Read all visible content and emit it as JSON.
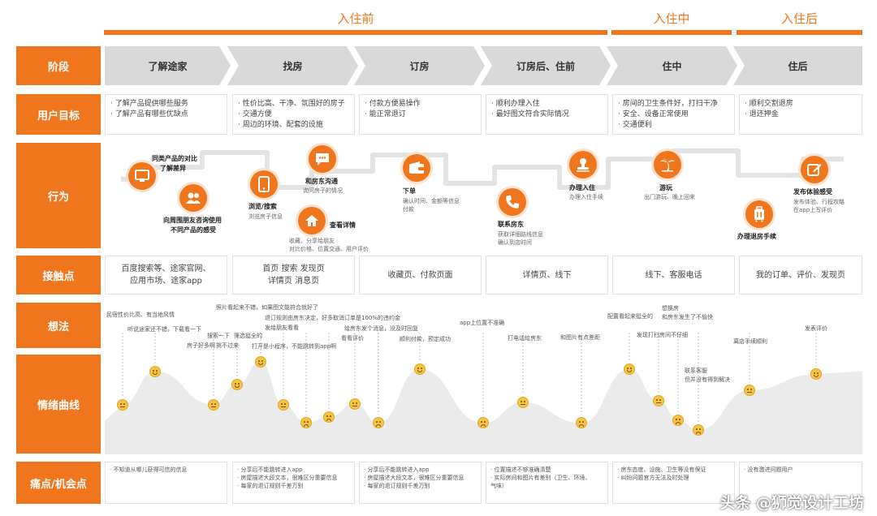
{
  "phases": [
    {
      "title": "入住前"
    },
    {
      "title": "入住中"
    },
    {
      "title": "入住后"
    }
  ],
  "row_labels": [
    "阶段",
    "用户目标",
    "行为",
    "接触点",
    "想法",
    "情绪曲线",
    "痛点/机会点"
  ],
  "stages": [
    "了解途家",
    "找房",
    "订房",
    "订房后、住前",
    "住中",
    "住后"
  ],
  "goals": [
    [
      "· 了解产品提供哪些服务",
      "· 了解产品有哪些优缺点"
    ],
    [
      "· 性价比高、干净、氛围好的房子",
      "· 交通方便",
      "· 周边的环境、配套的设施"
    ],
    [
      "· 付款方便易操作",
      "· 能正常退订"
    ],
    [
      "· 顺利办理入住",
      "· 最好图文符合实际情况"
    ],
    [
      "· 房间的卫生条件好，打扫干净",
      "· 安全、设备正常使用",
      "· 交通便利"
    ],
    [
      "· 顺利交割退房",
      "· 退还押金"
    ]
  ],
  "actions": [
    {
      "icon": "monitor-icon",
      "title": "同类产品的对比",
      "title2": "了解差异",
      "desc": ""
    },
    {
      "icon": "users-icon",
      "title": "向周围朋友咨询使用",
      "title2": "不同产品的感受",
      "desc": ""
    },
    {
      "icon": "phone-icon",
      "title": "浏览/搜索",
      "title2": "",
      "desc": "浏览房子信息"
    },
    {
      "icon": "chat-icon",
      "title": "和房东沟通",
      "title2": "",
      "desc": "询问房子的情况"
    },
    {
      "icon": "home-icon",
      "title": "查看详情",
      "title2": "",
      "desc": "收藏、分享给朋友",
      "desc2": "对比价格、位置交通、用户评价"
    },
    {
      "icon": "wallet-icon",
      "title": "下单",
      "title2": "",
      "desc": "确认时间、金额等信息",
      "desc2": "付款"
    },
    {
      "icon": "call-icon",
      "title": "联系房东",
      "title2": "",
      "desc": "获取详细路线信息",
      "desc2": "确认到店时间"
    },
    {
      "icon": "stamp-icon",
      "title": "办理入住",
      "title2": "",
      "desc": "办理入住手续"
    },
    {
      "icon": "palm-icon",
      "title": "游玩",
      "title2": "",
      "desc": "出门游玩、晚上回来"
    },
    {
      "icon": "luggage-icon",
      "title": "办理退房手续",
      "title2": "",
      "desc": ""
    },
    {
      "icon": "edit-icon",
      "title": "发布体验感受",
      "title2": "",
      "desc": "发布体验、行程攻略",
      "desc2": "在app上写评价"
    }
  ],
  "touchpoints": [
    [
      "百度搜索等、途家官网、",
      "应用市场、途家app"
    ],
    [
      "首页 搜索 发现页",
      "详情页 消息页"
    ],
    [
      "收藏页、付款页面"
    ],
    [
      "详情页、线下"
    ],
    [
      "线下、客服电话"
    ],
    [
      "我的订单、评价、发现页"
    ]
  ],
  "thoughts": [
    "民宿性价比高、有当地风情",
    "听说途家还不错，下载看一下",
    "搜索一下",
    "房子好多啊",
    "挑不过来",
    "照片看起来不错，如果图文能符合就好了",
    "筛选挺全的",
    "退订规则由房东决定，好多取消订单是100%的违约金",
    "发给朋友看看",
    "打开是小程序，不能跳转到app啊",
    "给房东发个消息，没及时回复",
    "看看评价",
    "顺利付款，预定成功",
    "app上位置不准确",
    "打电话给房东",
    "和图片有点差距",
    "配置看起来挺全的",
    "想换房",
    "和房东发生了不愉快",
    "发现打扫房间不仔细",
    "联系客服",
    "但并没有得到解决",
    "离店手续顺利",
    "发表评价"
  ],
  "pains": [
    [
      "· 不知道从哪儿获得可信的信息"
    ],
    [
      "· 分享后不能跳转进入app",
      "· 房屋描述大段文本，很难区分重要信息",
      "· 每家的退订规则千差万别"
    ],
    [
      "· 分享后不能跳转进入app",
      "· 房屋描述大段文本，很难区分重要信息",
      "· 每家的退订规则千差万别"
    ],
    [
      "· 位置描述不够准确清楚",
      "· 实际房间和图片有差别（卫生、环境、",
      "  气味）"
    ],
    [
      "· 房东态度、设施、卫生等没有保证",
      "· 纠纷问题官方无法及时处理"
    ],
    [
      "· 没有激进问题用户"
    ]
  ],
  "emotions": [
    {
      "mood": "neutral",
      "level": 0.45
    },
    {
      "mood": "happy",
      "level": 0.78
    },
    {
      "mood": "neutral",
      "level": 0.45
    },
    {
      "mood": "happy",
      "level": 0.65
    },
    {
      "mood": "happy",
      "level": 0.87
    },
    {
      "mood": "neutral",
      "level": 0.45
    },
    {
      "mood": "sad",
      "level": 0.27
    },
    {
      "mood": "sad",
      "level": 0.33
    },
    {
      "mood": "neutral",
      "level": 0.46
    },
    {
      "mood": "sad",
      "level": 0.27
    },
    {
      "mood": "happy",
      "level": 0.8
    },
    {
      "mood": "sad",
      "level": 0.27
    },
    {
      "mood": "neutral",
      "level": 0.47
    },
    {
      "mood": "sad",
      "level": 0.27
    },
    {
      "mood": "happy",
      "level": 0.8
    },
    {
      "mood": "neutral",
      "level": 0.49
    },
    {
      "mood": "sad",
      "level": 0.3
    },
    {
      "mood": "sad",
      "level": 0.2
    },
    {
      "mood": "neutral",
      "level": 0.59
    },
    {
      "mood": "happy",
      "level": 0.75
    }
  ],
  "watermark": "头条 @狮觉设计工坊",
  "colors": {
    "accent": "#f0761e",
    "stage_bg": "#d9d9d9",
    "curve_fill": "#ebebeb",
    "emoji": "#f6c443"
  }
}
